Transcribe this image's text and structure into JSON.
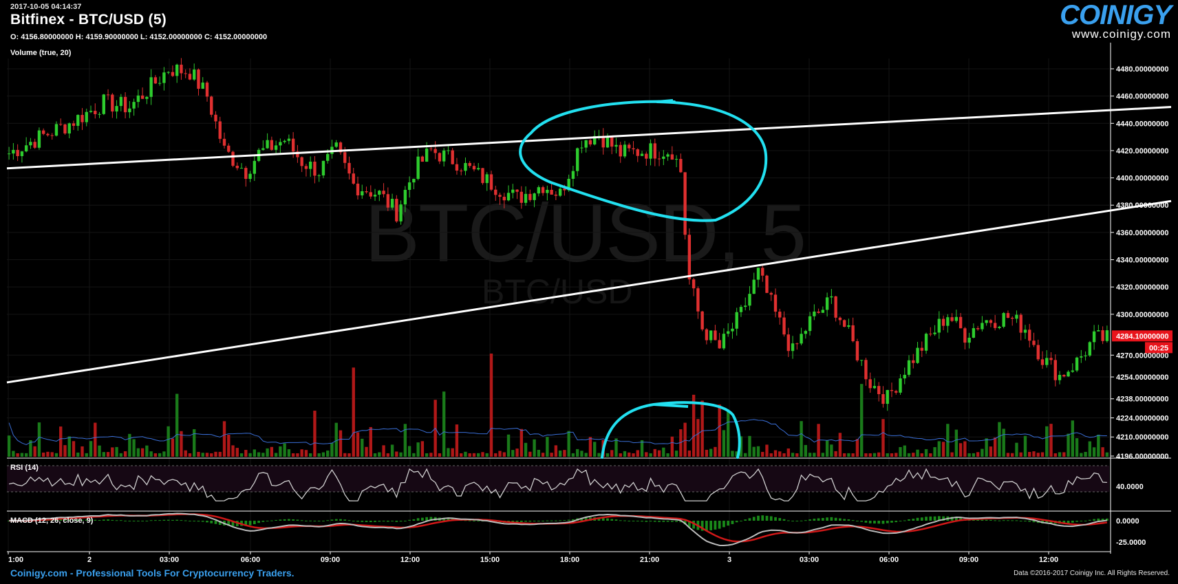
{
  "header": {
    "timestamp": "2017-10-05 04:14:37",
    "title": "Bitfinex - BTC/USD (5)",
    "ohlc": "O: 4156.80000000 H: 4159.90000000 L: 4152.00000000 C: 4152.00000000",
    "volume_label": "Volume (true, 20)"
  },
  "logo": {
    "word": "COINIGY",
    "url": "www.coinigy.com"
  },
  "watermark": {
    "big": "BTC/USD, 5",
    "small": "BTC/USD"
  },
  "footer": {
    "left": "Coinigy.com - Professional Tools For Cryptocurrency Traders.",
    "right": "Data ©2016-2017 Coinigy Inc. All Rights Reserved."
  },
  "colors": {
    "up": "#2ecc2e",
    "down": "#e03030",
    "annotation": "#22e0f0",
    "trendline": "#ffffff",
    "price_badge": "#e8141c",
    "logo": "#3aa0ee"
  },
  "chart_data": {
    "type": "candlestick",
    "price_axis": {
      "ticks": [
        4480,
        4460,
        4440,
        4420,
        4400,
        4380,
        4360,
        4340,
        4320,
        4300,
        4284.1,
        4270,
        4254,
        4238,
        4224,
        4210,
        4196
      ],
      "tick_labels": [
        "4480.00000000",
        "4460.00000000",
        "4440.00000000",
        "4420.00000000",
        "4400.00000000",
        "4380.00000000",
        "4360.00000000",
        "4340.00000000",
        "4320.00000000",
        "4300.00000000",
        "4270.00000000",
        "4254.00000000",
        "4238.00000000",
        "4224.00000000",
        "4210.00000000",
        "4196.00000000"
      ],
      "last_price_label": "4284.10000000",
      "countdown_label": "00:25"
    },
    "time_axis": {
      "labels": [
        "1:00",
        "2",
        "03:00",
        "06:00",
        "09:00",
        "12:00",
        "15:00",
        "18:00",
        "21:00",
        "3",
        "03:00",
        "06:00",
        "09:00",
        "12:00"
      ]
    },
    "price_path": [
      [
        0,
        4418
      ],
      [
        6,
        4428
      ],
      [
        14,
        4440
      ],
      [
        22,
        4455
      ],
      [
        28,
        4452
      ],
      [
        34,
        4470
      ],
      [
        37,
        4480
      ],
      [
        42,
        4478
      ],
      [
        46,
        4460
      ],
      [
        50,
        4420
      ],
      [
        55,
        4405
      ],
      [
        58,
        4418
      ],
      [
        64,
        4428
      ],
      [
        68,
        4412
      ],
      [
        72,
        4405
      ],
      [
        76,
        4420
      ],
      [
        80,
        4395
      ],
      [
        86,
        4388
      ],
      [
        90,
        4375
      ],
      [
        94,
        4405
      ],
      [
        98,
        4420
      ],
      [
        104,
        4412
      ],
      [
        110,
        4400
      ],
      [
        114,
        4392
      ],
      [
        118,
        4385
      ],
      [
        124,
        4395
      ],
      [
        128,
        4388
      ],
      [
        133,
        4428
      ],
      [
        137,
        4432
      ],
      [
        142,
        4418
      ],
      [
        148,
        4420
      ],
      [
        154,
        4420
      ],
      [
        156,
        4405
      ],
      [
        157,
        4360
      ],
      [
        158,
        4325
      ],
      [
        161,
        4290
      ],
      [
        165,
        4275
      ],
      [
        170,
        4300
      ],
      [
        174,
        4330
      ],
      [
        178,
        4300
      ],
      [
        182,
        4272
      ],
      [
        186,
        4295
      ],
      [
        191,
        4310
      ],
      [
        195,
        4285
      ],
      [
        200,
        4250
      ],
      [
        204,
        4238
      ],
      [
        208,
        4260
      ],
      [
        213,
        4280
      ],
      [
        218,
        4300
      ],
      [
        222,
        4285
      ],
      [
        226,
        4295
      ],
      [
        232,
        4298
      ],
      [
        236,
        4290
      ],
      [
        240,
        4268
      ],
      [
        244,
        4255
      ],
      [
        248,
        4265
      ],
      [
        252,
        4282
      ],
      [
        256,
        4282
      ]
    ],
    "volume_series": {
      "name": "Volume (true, 20)"
    },
    "indicators": [
      {
        "name": "RSI (14)",
        "tick_labels": [
          "40.0000"
        ]
      },
      {
        "name": "MACD (12, 26, close, 9)",
        "tick_labels": [
          "0.0000",
          "-25.0000"
        ]
      }
    ],
    "annotations": [
      {
        "type": "trendline",
        "from": [
          0,
          4407
        ],
        "to": [
          256,
          4452
        ]
      },
      {
        "type": "trendline",
        "from": [
          0,
          4250
        ],
        "to": [
          256,
          4383
        ]
      },
      {
        "type": "ellipse",
        "label": "",
        "color": "#22e0f0"
      },
      {
        "type": "arc",
        "label": "",
        "color": "#22e0f0"
      }
    ]
  }
}
